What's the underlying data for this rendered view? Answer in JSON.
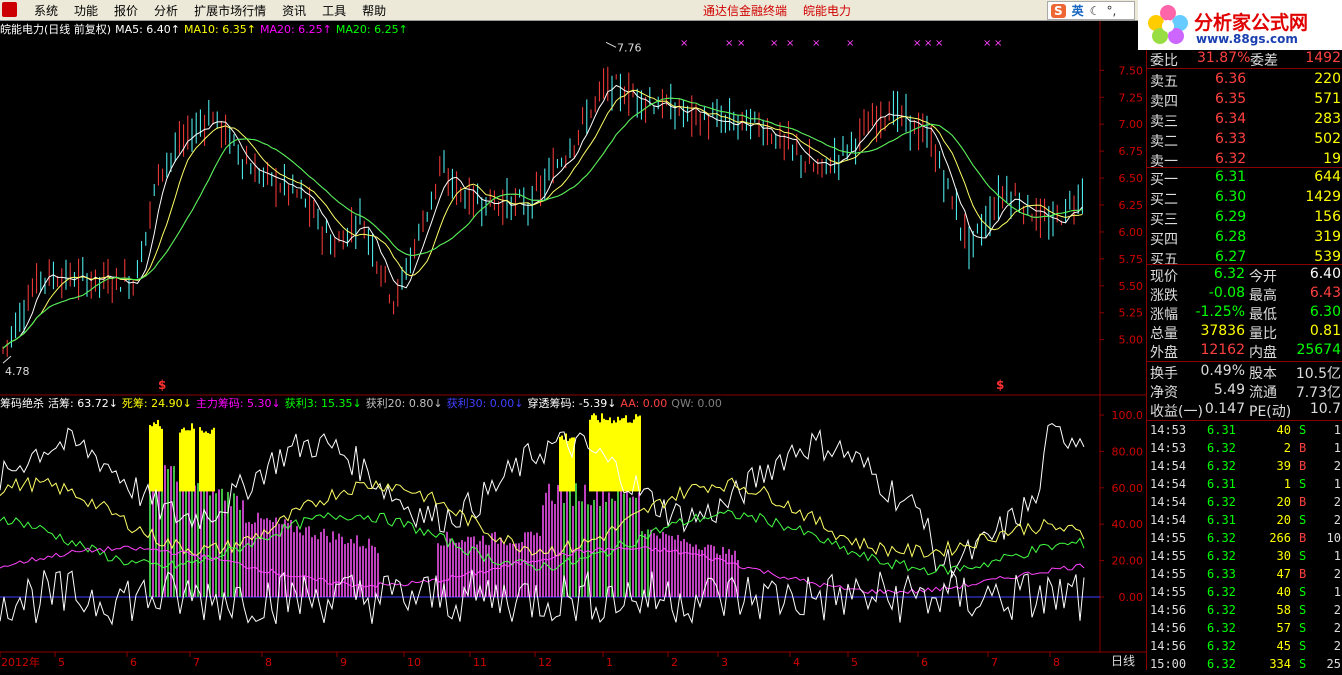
{
  "menu": {
    "items": [
      "系统",
      "功能",
      "报价",
      "分析",
      "扩展市场行情",
      "资讯",
      "工具",
      "帮助"
    ],
    "center_title": "通达信金融终端",
    "stock_name": "皖能电力"
  },
  "ime": {
    "lang": "英"
  },
  "brand": {
    "title": "分析家公式网",
    "url": "www.88gs.com"
  },
  "main_chart": {
    "title": "皖能电力(日线 前复权)",
    "ma": [
      {
        "label": "MA5:",
        "value": "6.40",
        "color": "#ffffff"
      },
      {
        "label": "MA10:",
        "value": "6.35",
        "color": "#ffff00"
      },
      {
        "label": "MA20:",
        "value": "6.25",
        "color": "#ff00ff"
      },
      {
        "label": "MA20:",
        "value": "6.25",
        "color": "#00ff00"
      }
    ],
    "price_axis": [
      "7.50",
      "7.25",
      "7.00",
      "6.75",
      "6.50",
      "6.25",
      "6.00",
      "5.75",
      "5.50",
      "5.25",
      "5.00"
    ],
    "high_label": "7.76",
    "low_label": "4.78",
    "s_marker": "$"
  },
  "indicator": {
    "name": "筹码绝杀",
    "items": [
      {
        "label": "活筹:",
        "value": "63.72",
        "color": "#ffffff"
      },
      {
        "label": "死筹:",
        "value": "24.90",
        "color": "#ffff00"
      },
      {
        "label": "主力筹码:",
        "value": "5.30",
        "color": "#ff00ff"
      },
      {
        "label": "获利3:",
        "value": "15.35",
        "color": "#00ff00"
      },
      {
        "label": "获利20:",
        "value": "0.80",
        "color": "#c0c0c0"
      },
      {
        "label": "获利30:",
        "value": "0.00",
        "color": "#4040ff"
      },
      {
        "label": "穿透筹码:",
        "value": "-5.39",
        "color": "#ffffff"
      },
      {
        "label": "AA:",
        "value": "0.00",
        "color": "#ff4040"
      },
      {
        "label": "QW:",
        "value": "0.00",
        "color": "#808080"
      }
    ],
    "axis": [
      "100.0",
      "80.00",
      "60.00",
      "40.00",
      "20.00",
      "0.00"
    ]
  },
  "time_axis": {
    "labels": [
      "2012年",
      "5",
      "6",
      "7",
      "8",
      "9",
      "10",
      "11",
      "12",
      "1",
      "2",
      "3",
      "4",
      "5",
      "6",
      "7",
      "8"
    ],
    "tab": "日线"
  },
  "quote": {
    "weibi_label": "委比",
    "weibi_value": "31.87%",
    "weicha_label": "委差",
    "weicha_value": "1492",
    "sell": [
      {
        "label": "卖五",
        "price": "6.36",
        "vol": "220"
      },
      {
        "label": "卖四",
        "price": "6.35",
        "vol": "571"
      },
      {
        "label": "卖三",
        "price": "6.34",
        "vol": "283"
      },
      {
        "label": "卖二",
        "price": "6.33",
        "vol": "502"
      },
      {
        "label": "卖一",
        "price": "6.32",
        "vol": "19"
      }
    ],
    "buy": [
      {
        "label": "买一",
        "price": "6.31",
        "vol": "644"
      },
      {
        "label": "买二",
        "price": "6.30",
        "vol": "1429"
      },
      {
        "label": "买三",
        "price": "6.29",
        "vol": "156"
      },
      {
        "label": "买四",
        "price": "6.28",
        "vol": "319"
      },
      {
        "label": "买五",
        "price": "6.27",
        "vol": "539"
      }
    ],
    "stats": [
      {
        "l1": "现价",
        "v1": "6.32",
        "c1": "#00ff00",
        "l2": "今开",
        "v2": "6.40",
        "c2": "#ffffff"
      },
      {
        "l1": "涨跌",
        "v1": "-0.08",
        "c1": "#00ff00",
        "l2": "最高",
        "v2": "6.43",
        "c2": "#ff4040"
      },
      {
        "l1": "涨幅",
        "v1": "-1.25%",
        "c1": "#00ff00",
        "l2": "最低",
        "v2": "6.30",
        "c2": "#00ff00"
      },
      {
        "l1": "总量",
        "v1": "37836",
        "c1": "#ffff00",
        "l2": "量比",
        "v2": "0.81",
        "c2": "#ffff00"
      },
      {
        "l1": "外盘",
        "v1": "12162",
        "c1": "#ff4040",
        "l2": "内盘",
        "v2": "25674",
        "c2": "#00ff00"
      }
    ],
    "stats2": [
      {
        "l1": "换手",
        "v1": "0.49%",
        "l2": "股本",
        "v2": "10.5亿"
      },
      {
        "l1": "净资",
        "v1": "5.49",
        "l2": "流通",
        "v2": "7.73亿"
      },
      {
        "l1": "收益(一)",
        "v1": "0.147",
        "l2": "PE(动)",
        "v2": "10.7"
      }
    ],
    "ticks": [
      {
        "t": "14:53",
        "p": "6.31",
        "v": "40",
        "d": "S",
        "n": "1"
      },
      {
        "t": "14:53",
        "p": "6.32",
        "v": "2",
        "d": "B",
        "n": "1"
      },
      {
        "t": "14:54",
        "p": "6.32",
        "v": "39",
        "d": "B",
        "n": "2"
      },
      {
        "t": "14:54",
        "p": "6.31",
        "v": "1",
        "d": "S",
        "n": "1"
      },
      {
        "t": "14:54",
        "p": "6.32",
        "v": "20",
        "d": "B",
        "n": "2"
      },
      {
        "t": "14:54",
        "p": "6.31",
        "v": "20",
        "d": "S",
        "n": "2"
      },
      {
        "t": "14:55",
        "p": "6.32",
        "v": "266",
        "d": "B",
        "n": "10"
      },
      {
        "t": "14:55",
        "p": "6.32",
        "v": "30",
        "d": "S",
        "n": "1"
      },
      {
        "t": "14:55",
        "p": "6.33",
        "v": "47",
        "d": "B",
        "n": "2"
      },
      {
        "t": "14:55",
        "p": "6.32",
        "v": "40",
        "d": "S",
        "n": "1"
      },
      {
        "t": "14:56",
        "p": "6.32",
        "v": "58",
        "d": "S",
        "n": "2"
      },
      {
        "t": "14:56",
        "p": "6.32",
        "v": "57",
        "d": "S",
        "n": "2"
      },
      {
        "t": "14:56",
        "p": "6.32",
        "v": "45",
        "d": "S",
        "n": "2"
      },
      {
        "t": "15:00",
        "p": "6.32",
        "v": "334",
        "d": "S",
        "n": "25"
      }
    ]
  }
}
